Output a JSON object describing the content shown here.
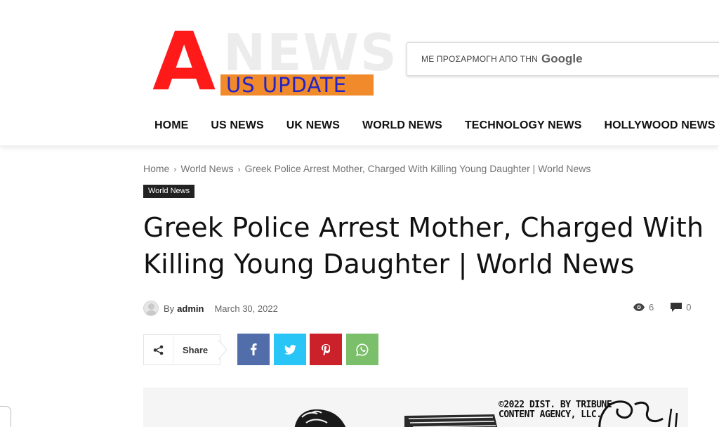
{
  "logo": {
    "letter": "A",
    "background_word": "NEWS",
    "subtitle": "US UPDATE",
    "colors": {
      "letter": "#ff1a1a",
      "bar": "#f08a2a",
      "subtitle": "#2323c8"
    }
  },
  "search": {
    "label": "ΜΕ ΠΡΟΣΑΡΜΟΓΗ ΑΠΟ ΤΗΝ",
    "brand": "Google"
  },
  "nav": {
    "items": [
      {
        "label": "HOME"
      },
      {
        "label": "US NEWS"
      },
      {
        "label": "UK NEWS"
      },
      {
        "label": "WORLD NEWS"
      },
      {
        "label": "TECHNOLOGY NEWS"
      },
      {
        "label": "HOLLYWOOD NEWS"
      }
    ]
  },
  "breadcrumb": {
    "items": [
      {
        "label": "Home"
      },
      {
        "label": "World News"
      },
      {
        "label": "Greek Police Arrest Mother, Charged With Killing Young Daughter | World News"
      }
    ],
    "separator": "›"
  },
  "article": {
    "category": "World News",
    "title": "Greek Police Arrest Mother, Charged With Killing Young Daughter | World News",
    "by_label": "By",
    "author": "admin",
    "date": "March 30, 2022",
    "views": "6",
    "comments": "0"
  },
  "share": {
    "label": "Share",
    "buttons": [
      {
        "network": "facebook",
        "icon": "facebook-icon",
        "color": "#516eab"
      },
      {
        "network": "twitter",
        "icon": "twitter-icon",
        "color": "#29c5f6"
      },
      {
        "network": "pinterest",
        "icon": "pinterest-icon",
        "color": "#ca212a"
      },
      {
        "network": "whatsapp",
        "icon": "whatsapp-icon",
        "color": "#7bbf6a"
      }
    ]
  },
  "image": {
    "credit_line1": "©2022 DIST. BY TRIBUNE",
    "credit_line2": "CONTENT AGENCY, LLC."
  }
}
